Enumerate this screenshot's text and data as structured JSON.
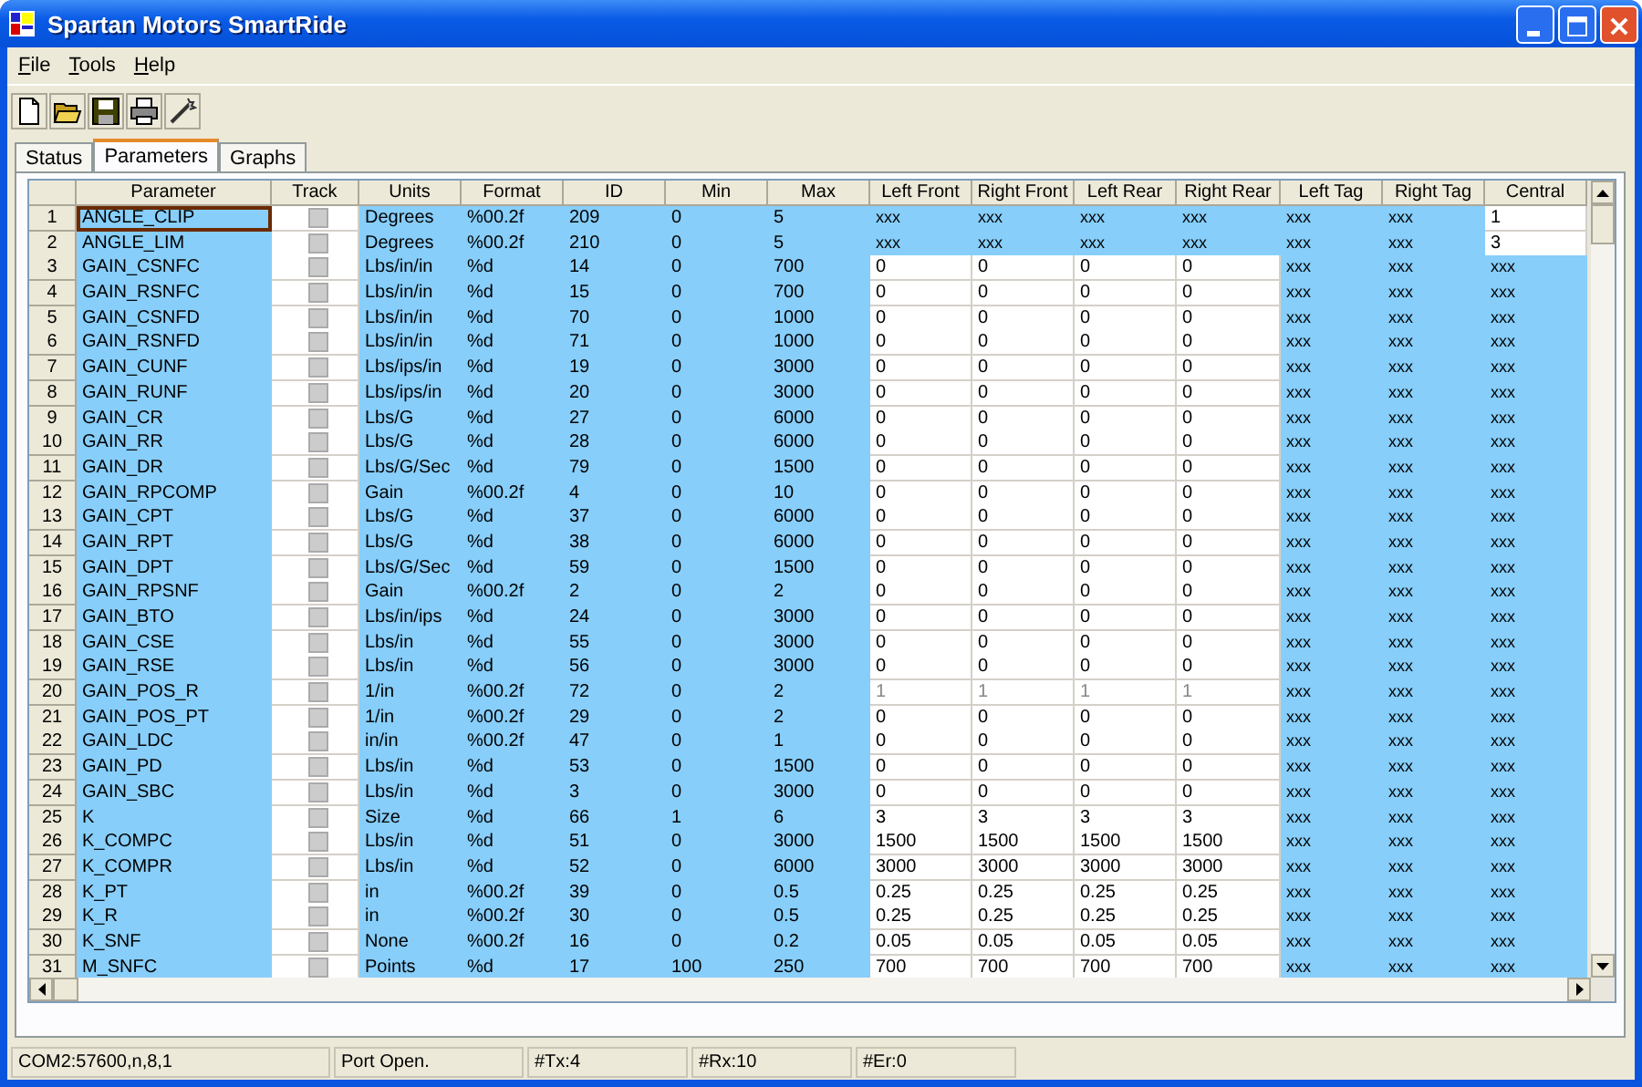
{
  "window": {
    "title": "Spartan Motors SmartRide"
  },
  "menu": [
    {
      "label": "File"
    },
    {
      "label": "Tools"
    },
    {
      "label": "Help"
    }
  ],
  "tabs": [
    {
      "label": "Status",
      "selected": false
    },
    {
      "label": "Parameters",
      "selected": true
    },
    {
      "label": "Graphs",
      "selected": false
    }
  ],
  "table": {
    "columns": [
      "Parameter",
      "Track",
      "Units",
      "Format",
      "ID",
      "Min",
      "Max",
      "Left Front",
      "Right Front",
      "Left Rear",
      "Right Rear",
      "Left Tag",
      "Right Tag",
      "Central"
    ],
    "rows": [
      {
        "n": "1",
        "parameter": "ANGLE_CLIP",
        "selected": true,
        "track_checked": false,
        "units": "Degrees",
        "format": "%00.2f",
        "id": "209",
        "min": "0",
        "max": "5",
        "corners": [
          "xxx",
          "xxx",
          "xxx",
          "xxx"
        ],
        "corners_editable": false,
        "corners_disabled": false,
        "tags": [
          "xxx",
          "xxx"
        ],
        "central": "1",
        "central_editable": true
      },
      {
        "n": "2",
        "parameter": "ANGLE_LIM",
        "selected": false,
        "track_checked": false,
        "units": "Degrees",
        "format": "%00.2f",
        "id": "210",
        "min": "0",
        "max": "5",
        "corners": [
          "xxx",
          "xxx",
          "xxx",
          "xxx"
        ],
        "corners_editable": false,
        "corners_disabled": false,
        "tags": [
          "xxx",
          "xxx"
        ],
        "central": "3",
        "central_editable": true
      },
      {
        "n": "3",
        "parameter": "GAIN_CSNFC",
        "selected": false,
        "track_checked": false,
        "units": "Lbs/in/in",
        "format": "%d",
        "id": "14",
        "min": "0",
        "max": "700",
        "corners": [
          "0",
          "0",
          "0",
          "0"
        ],
        "corners_editable": true,
        "corners_disabled": false,
        "tags": [
          "xxx",
          "xxx"
        ],
        "central": "xxx",
        "central_editable": false
      },
      {
        "n": "4",
        "parameter": "GAIN_RSNFC",
        "selected": false,
        "track_checked": false,
        "units": "Lbs/in/in",
        "format": "%d",
        "id": "15",
        "min": "0",
        "max": "700",
        "corners": [
          "0",
          "0",
          "0",
          "0"
        ],
        "corners_editable": true,
        "corners_disabled": false,
        "tags": [
          "xxx",
          "xxx"
        ],
        "central": "xxx",
        "central_editable": false
      },
      {
        "n": "5",
        "parameter": "GAIN_CSNFD",
        "selected": false,
        "track_checked": false,
        "units": "Lbs/in/in",
        "format": "%d",
        "id": "70",
        "min": "0",
        "max": "1000",
        "corners": [
          "0",
          "0",
          "0",
          "0"
        ],
        "corners_editable": true,
        "corners_disabled": false,
        "tags": [
          "xxx",
          "xxx"
        ],
        "central": "xxx",
        "central_editable": false
      },
      {
        "n": "6",
        "parameter": "GAIN_RSNFD",
        "selected": false,
        "track_checked": false,
        "units": "Lbs/in/in",
        "format": "%d",
        "id": "71",
        "min": "0",
        "max": "1000",
        "corners": [
          "0",
          "0",
          "0",
          "0"
        ],
        "corners_editable": true,
        "corners_disabled": false,
        "tags": [
          "xxx",
          "xxx"
        ],
        "central": "xxx",
        "central_editable": false
      },
      {
        "n": "7",
        "parameter": "GAIN_CUNF",
        "selected": false,
        "track_checked": false,
        "units": "Lbs/ips/in",
        "format": "%d",
        "id": "19",
        "min": "0",
        "max": "3000",
        "corners": [
          "0",
          "0",
          "0",
          "0"
        ],
        "corners_editable": true,
        "corners_disabled": false,
        "tags": [
          "xxx",
          "xxx"
        ],
        "central": "xxx",
        "central_editable": false
      },
      {
        "n": "8",
        "parameter": "GAIN_RUNF",
        "selected": false,
        "track_checked": false,
        "units": "Lbs/ips/in",
        "format": "%d",
        "id": "20",
        "min": "0",
        "max": "3000",
        "corners": [
          "0",
          "0",
          "0",
          "0"
        ],
        "corners_editable": true,
        "corners_disabled": false,
        "tags": [
          "xxx",
          "xxx"
        ],
        "central": "xxx",
        "central_editable": false
      },
      {
        "n": "9",
        "parameter": "GAIN_CR",
        "selected": false,
        "track_checked": false,
        "units": "Lbs/G",
        "format": "%d",
        "id": "27",
        "min": "0",
        "max": "6000",
        "corners": [
          "0",
          "0",
          "0",
          "0"
        ],
        "corners_editable": true,
        "corners_disabled": false,
        "tags": [
          "xxx",
          "xxx"
        ],
        "central": "xxx",
        "central_editable": false
      },
      {
        "n": "10",
        "parameter": "GAIN_RR",
        "selected": false,
        "track_checked": false,
        "units": "Lbs/G",
        "format": "%d",
        "id": "28",
        "min": "0",
        "max": "6000",
        "corners": [
          "0",
          "0",
          "0",
          "0"
        ],
        "corners_editable": true,
        "corners_disabled": false,
        "tags": [
          "xxx",
          "xxx"
        ],
        "central": "xxx",
        "central_editable": false
      },
      {
        "n": "11",
        "parameter": "GAIN_DR",
        "selected": false,
        "track_checked": false,
        "units": "Lbs/G/Sec",
        "format": "%d",
        "id": "79",
        "min": "0",
        "max": "1500",
        "corners": [
          "0",
          "0",
          "0",
          "0"
        ],
        "corners_editable": true,
        "corners_disabled": false,
        "tags": [
          "xxx",
          "xxx"
        ],
        "central": "xxx",
        "central_editable": false
      },
      {
        "n": "12",
        "parameter": "GAIN_RPCOMP",
        "selected": false,
        "track_checked": false,
        "units": "Gain",
        "format": "%00.2f",
        "id": "4",
        "min": "0",
        "max": "10",
        "corners": [
          "0",
          "0",
          "0",
          "0"
        ],
        "corners_editable": true,
        "corners_disabled": false,
        "tags": [
          "xxx",
          "xxx"
        ],
        "central": "xxx",
        "central_editable": false
      },
      {
        "n": "13",
        "parameter": "GAIN_CPT",
        "selected": false,
        "track_checked": false,
        "units": "Lbs/G",
        "format": "%d",
        "id": "37",
        "min": "0",
        "max": "6000",
        "corners": [
          "0",
          "0",
          "0",
          "0"
        ],
        "corners_editable": true,
        "corners_disabled": false,
        "tags": [
          "xxx",
          "xxx"
        ],
        "central": "xxx",
        "central_editable": false
      },
      {
        "n": "14",
        "parameter": "GAIN_RPT",
        "selected": false,
        "track_checked": false,
        "units": "Lbs/G",
        "format": "%d",
        "id": "38",
        "min": "0",
        "max": "6000",
        "corners": [
          "0",
          "0",
          "0",
          "0"
        ],
        "corners_editable": true,
        "corners_disabled": false,
        "tags": [
          "xxx",
          "xxx"
        ],
        "central": "xxx",
        "central_editable": false
      },
      {
        "n": "15",
        "parameter": "GAIN_DPT",
        "selected": false,
        "track_checked": false,
        "units": "Lbs/G/Sec",
        "format": "%d",
        "id": "59",
        "min": "0",
        "max": "1500",
        "corners": [
          "0",
          "0",
          "0",
          "0"
        ],
        "corners_editable": true,
        "corners_disabled": false,
        "tags": [
          "xxx",
          "xxx"
        ],
        "central": "xxx",
        "central_editable": false
      },
      {
        "n": "16",
        "parameter": "GAIN_RPSNF",
        "selected": false,
        "track_checked": false,
        "units": "Gain",
        "format": "%00.2f",
        "id": "2",
        "min": "0",
        "max": "2",
        "corners": [
          "0",
          "0",
          "0",
          "0"
        ],
        "corners_editable": true,
        "corners_disabled": false,
        "tags": [
          "xxx",
          "xxx"
        ],
        "central": "xxx",
        "central_editable": false
      },
      {
        "n": "17",
        "parameter": "GAIN_BTO",
        "selected": false,
        "track_checked": false,
        "units": "Lbs/in/ips",
        "format": "%d",
        "id": "24",
        "min": "0",
        "max": "3000",
        "corners": [
          "0",
          "0",
          "0",
          "0"
        ],
        "corners_editable": true,
        "corners_disabled": false,
        "tags": [
          "xxx",
          "xxx"
        ],
        "central": "xxx",
        "central_editable": false
      },
      {
        "n": "18",
        "parameter": "GAIN_CSE",
        "selected": false,
        "track_checked": false,
        "units": "Lbs/in",
        "format": "%d",
        "id": "55",
        "min": "0",
        "max": "3000",
        "corners": [
          "0",
          "0",
          "0",
          "0"
        ],
        "corners_editable": true,
        "corners_disabled": false,
        "tags": [
          "xxx",
          "xxx"
        ],
        "central": "xxx",
        "central_editable": false
      },
      {
        "n": "19",
        "parameter": "GAIN_RSE",
        "selected": false,
        "track_checked": false,
        "units": "Lbs/in",
        "format": "%d",
        "id": "56",
        "min": "0",
        "max": "3000",
        "corners": [
          "0",
          "0",
          "0",
          "0"
        ],
        "corners_editable": true,
        "corners_disabled": false,
        "tags": [
          "xxx",
          "xxx"
        ],
        "central": "xxx",
        "central_editable": false
      },
      {
        "n": "20",
        "parameter": "GAIN_POS_R",
        "selected": false,
        "track_checked": false,
        "units": "1/in",
        "format": "%00.2f",
        "id": "72",
        "min": "0",
        "max": "2",
        "corners": [
          "1",
          "1",
          "1",
          "1"
        ],
        "corners_editable": true,
        "corners_disabled": true,
        "tags": [
          "xxx",
          "xxx"
        ],
        "central": "xxx",
        "central_editable": false
      },
      {
        "n": "21",
        "parameter": "GAIN_POS_PT",
        "selected": false,
        "track_checked": false,
        "units": "1/in",
        "format": "%00.2f",
        "id": "29",
        "min": "0",
        "max": "2",
        "corners": [
          "0",
          "0",
          "0",
          "0"
        ],
        "corners_editable": true,
        "corners_disabled": false,
        "tags": [
          "xxx",
          "xxx"
        ],
        "central": "xxx",
        "central_editable": false
      },
      {
        "n": "22",
        "parameter": "GAIN_LDC",
        "selected": false,
        "track_checked": false,
        "units": "in/in",
        "format": "%00.2f",
        "id": "47",
        "min": "0",
        "max": "1",
        "corners": [
          "0",
          "0",
          "0",
          "0"
        ],
        "corners_editable": true,
        "corners_disabled": false,
        "tags": [
          "xxx",
          "xxx"
        ],
        "central": "xxx",
        "central_editable": false
      },
      {
        "n": "23",
        "parameter": "GAIN_PD",
        "selected": false,
        "track_checked": false,
        "units": "Lbs/in",
        "format": "%d",
        "id": "53",
        "min": "0",
        "max": "1500",
        "corners": [
          "0",
          "0",
          "0",
          "0"
        ],
        "corners_editable": true,
        "corners_disabled": false,
        "tags": [
          "xxx",
          "xxx"
        ],
        "central": "xxx",
        "central_editable": false
      },
      {
        "n": "24",
        "parameter": "GAIN_SBC",
        "selected": false,
        "track_checked": false,
        "units": "Lbs/in",
        "format": "%d",
        "id": "3",
        "min": "0",
        "max": "3000",
        "corners": [
          "0",
          "0",
          "0",
          "0"
        ],
        "corners_editable": true,
        "corners_disabled": false,
        "tags": [
          "xxx",
          "xxx"
        ],
        "central": "xxx",
        "central_editable": false
      },
      {
        "n": "25",
        "parameter": "K",
        "selected": false,
        "track_checked": false,
        "units": "Size",
        "format": "%d",
        "id": "66",
        "min": "1",
        "max": "6",
        "corners": [
          "3",
          "3",
          "3",
          "3"
        ],
        "corners_editable": true,
        "corners_disabled": false,
        "tags": [
          "xxx",
          "xxx"
        ],
        "central": "xxx",
        "central_editable": false
      },
      {
        "n": "26",
        "parameter": "K_COMPC",
        "selected": false,
        "track_checked": false,
        "units": "Lbs/in",
        "format": "%d",
        "id": "51",
        "min": "0",
        "max": "3000",
        "corners": [
          "1500",
          "1500",
          "1500",
          "1500"
        ],
        "corners_editable": true,
        "corners_disabled": false,
        "tags": [
          "xxx",
          "xxx"
        ],
        "central": "xxx",
        "central_editable": false
      },
      {
        "n": "27",
        "parameter": "K_COMPR",
        "selected": false,
        "track_checked": false,
        "units": "Lbs/in",
        "format": "%d",
        "id": "52",
        "min": "0",
        "max": "6000",
        "corners": [
          "3000",
          "3000",
          "3000",
          "3000"
        ],
        "corners_editable": true,
        "corners_disabled": false,
        "tags": [
          "xxx",
          "xxx"
        ],
        "central": "xxx",
        "central_editable": false
      },
      {
        "n": "28",
        "parameter": "K_PT",
        "selected": false,
        "track_checked": false,
        "units": "in",
        "format": "%00.2f",
        "id": "39",
        "min": "0",
        "max": "0.5",
        "corners": [
          "0.25",
          "0.25",
          "0.25",
          "0.25"
        ],
        "corners_editable": true,
        "corners_disabled": false,
        "tags": [
          "xxx",
          "xxx"
        ],
        "central": "xxx",
        "central_editable": false
      },
      {
        "n": "29",
        "parameter": "K_R",
        "selected": false,
        "track_checked": false,
        "units": "in",
        "format": "%00.2f",
        "id": "30",
        "min": "0",
        "max": "0.5",
        "corners": [
          "0.25",
          "0.25",
          "0.25",
          "0.25"
        ],
        "corners_editable": true,
        "corners_disabled": false,
        "tags": [
          "xxx",
          "xxx"
        ],
        "central": "xxx",
        "central_editable": false
      },
      {
        "n": "30",
        "parameter": "K_SNF",
        "selected": false,
        "track_checked": false,
        "units": "None",
        "format": "%00.2f",
        "id": "16",
        "min": "0",
        "max": "0.2",
        "corners": [
          "0.05",
          "0.05",
          "0.05",
          "0.05"
        ],
        "corners_editable": true,
        "corners_disabled": false,
        "tags": [
          "xxx",
          "xxx"
        ],
        "central": "xxx",
        "central_editable": false
      },
      {
        "n": "31",
        "parameter": "M_SNFC",
        "selected": false,
        "track_checked": false,
        "units": "Points",
        "format": "%d",
        "id": "17",
        "min": "100",
        "max": "250",
        "corners": [
          "700",
          "700",
          "700",
          "700"
        ],
        "corners_editable": true,
        "corners_disabled": false,
        "tags": [
          "xxx",
          "xxx"
        ],
        "central": "xxx",
        "central_editable": false
      }
    ]
  },
  "status_bar": [
    "COM2:57600,n,8,1",
    "Port Open.",
    "#Tx:4",
    "#Rx:10",
    "#Er:0"
  ]
}
